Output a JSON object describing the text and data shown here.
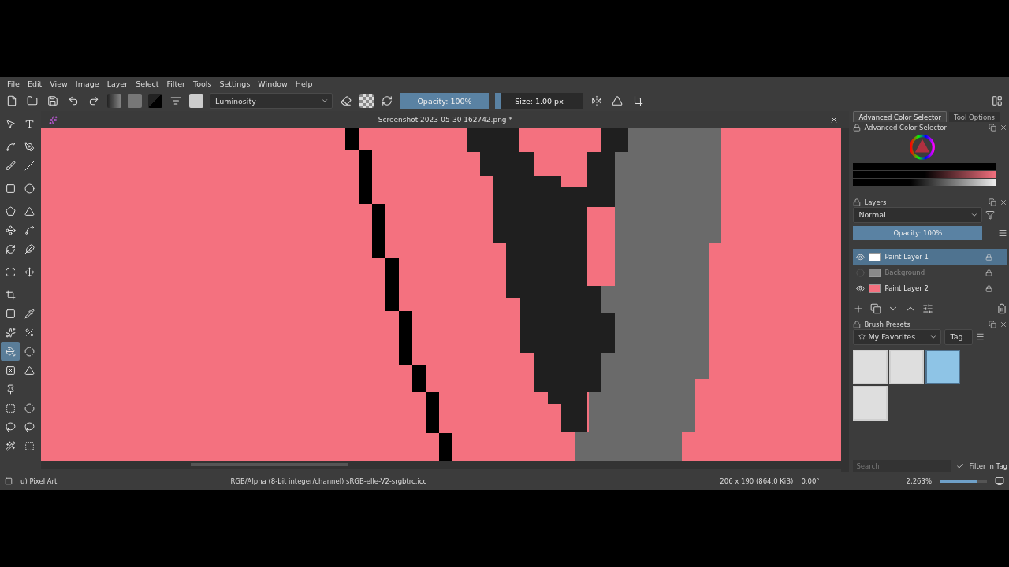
{
  "menu": [
    "File",
    "Edit",
    "View",
    "Image",
    "Layer",
    "Select",
    "Filter",
    "Tools",
    "Settings",
    "Window",
    "Help"
  ],
  "toolbar": {
    "blend_mode": "Luminosity",
    "opacity": {
      "label": "Opacity: 100%",
      "level": 1
    },
    "size": {
      "label": "Size: 1.00 px",
      "level": 0.06
    }
  },
  "document": {
    "title": "Screenshot 2023-05-30 162742.png *"
  },
  "tools": [
    {
      "selected": false
    },
    {
      "selected": false
    },
    {
      "selected": false
    },
    {
      "selected": false
    },
    {
      "selected": false
    },
    {
      "selected": false
    },
    {
      "selected": false
    },
    {
      "selected": false
    },
    {
      "selected": false
    },
    {
      "selected": false
    },
    {
      "selected": false
    },
    {
      "selected": false
    },
    {
      "selected": false
    },
    {
      "selected": false
    },
    {
      "selected": false
    },
    {
      "selected": false
    },
    {
      "selected": false
    },
    {
      "selected": false
    },
    {
      "selected": false
    },
    {
      "selected": false
    },
    {
      "selected": false
    },
    {
      "selected": true
    },
    {
      "selected": false
    },
    {
      "selected": false
    },
    {
      "selected": false
    },
    {
      "selected": false
    },
    {
      "selected": false
    },
    {
      "selected": false
    },
    {
      "selected": false
    },
    {
      "selected": false
    },
    {
      "selected": false
    },
    {
      "selected": false
    }
  ],
  "docker_tabs": [
    {
      "label": "Advanced Color Selector",
      "selected": true
    },
    {
      "label": "Tool Options",
      "selected": false
    }
  ],
  "color_selector": {
    "title": "Advanced Color Selector"
  },
  "layers": {
    "title": "Layers",
    "blend_mode": "Normal",
    "opacity": {
      "label": "Opacity:  100%",
      "level": 1
    },
    "items": [
      {
        "name": "Paint Layer 1",
        "visible": true,
        "selected": true,
        "color": "#ffffff"
      },
      {
        "name": "Background",
        "visible": false,
        "selected": false,
        "color": "#8a8a8a"
      },
      {
        "name": "Paint Layer 2",
        "visible": true,
        "selected": false,
        "color": "#f4717f"
      }
    ]
  },
  "brush_presets": {
    "title": "Brush Presets",
    "filter": "My Favorites",
    "tag": "Tag",
    "presets": [
      {
        "selected": false
      },
      {
        "selected": false
      },
      {
        "selected": true
      },
      {
        "selected": false
      }
    ],
    "search": {
      "placeholder": "Search"
    },
    "filter_in_tag": {
      "label": "Filter in Tag",
      "checked": true
    }
  },
  "status_bar": {
    "brush": "u) Pixel Art",
    "color_space": "RGB/Alpha (8-bit integer/channel)  sRGB-elle-V2-srgbtrc.icc",
    "dimensions": "206 x 190 (864.0 KiB)",
    "rotation": "0.00°",
    "zoom": {
      "label": "2,263%",
      "level": 0.78
    }
  }
}
